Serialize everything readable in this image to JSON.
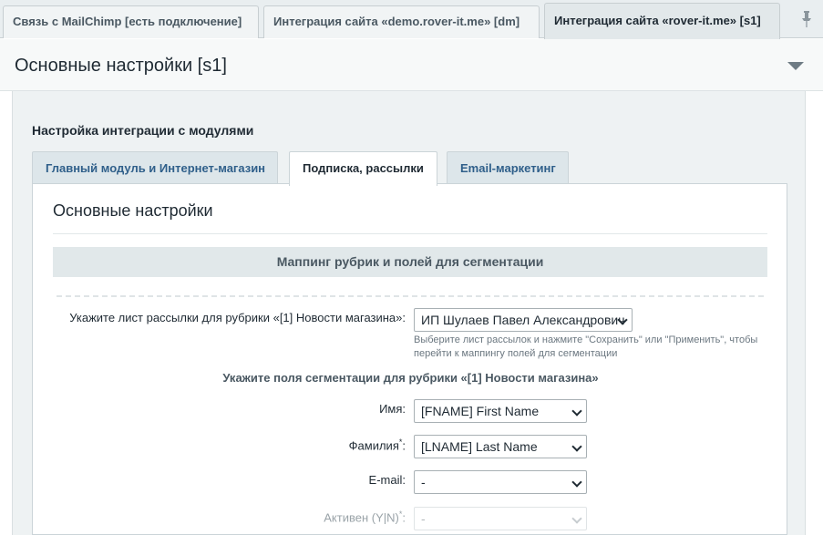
{
  "top_tabs": [
    {
      "label": "Связь с MailChimp [есть подключение]"
    },
    {
      "label": "Интеграция сайта «demo.rover-it.me» [dm]"
    },
    {
      "label": "Интеграция сайта «rover-it.me» [s1]"
    }
  ],
  "section": {
    "title": "Основные настройки [s1]"
  },
  "module_settings": {
    "title": "Настройка интеграции с модулями"
  },
  "inner_tabs": [
    {
      "label": "Главный модуль и Интернет-магазин"
    },
    {
      "label": "Подписка, рассылки"
    },
    {
      "label": "Email-маркетинг"
    }
  ],
  "card": {
    "title": "Основные настройки",
    "mapping_heading": "Маппинг рубрик и полей для сегментации",
    "list_label": "Укажите лист рассылки для рубрики «[1] Новости магазина»:",
    "list_value": "ИП Шулаев Павел Александрович",
    "hint_line1": "Выберите лист рассылок и нажмите \"Сохранить\" или \"Применить\", чтобы",
    "hint_line2": "перейти к маппингу полей для сегментации",
    "segmentation_title": "Укажите поля сегментации для рубрики «[1] Новости магазина»",
    "fields": [
      {
        "label": "Имя:",
        "value": "[FNAME] First Name"
      },
      {
        "label": "Фамилия",
        "required_mark": "*",
        "suffix": ":",
        "value": "[LNAME] Last Name"
      },
      {
        "label": "E-mail:",
        "value": "-"
      },
      {
        "label": "Активен (Y|N)",
        "required_mark": "*",
        "suffix": ":",
        "value": "-"
      }
    ]
  },
  "colors": {
    "accent_link": "#2f5f8a",
    "tab_bg": "#dde6ea",
    "band_bg": "#e1e8ea"
  }
}
